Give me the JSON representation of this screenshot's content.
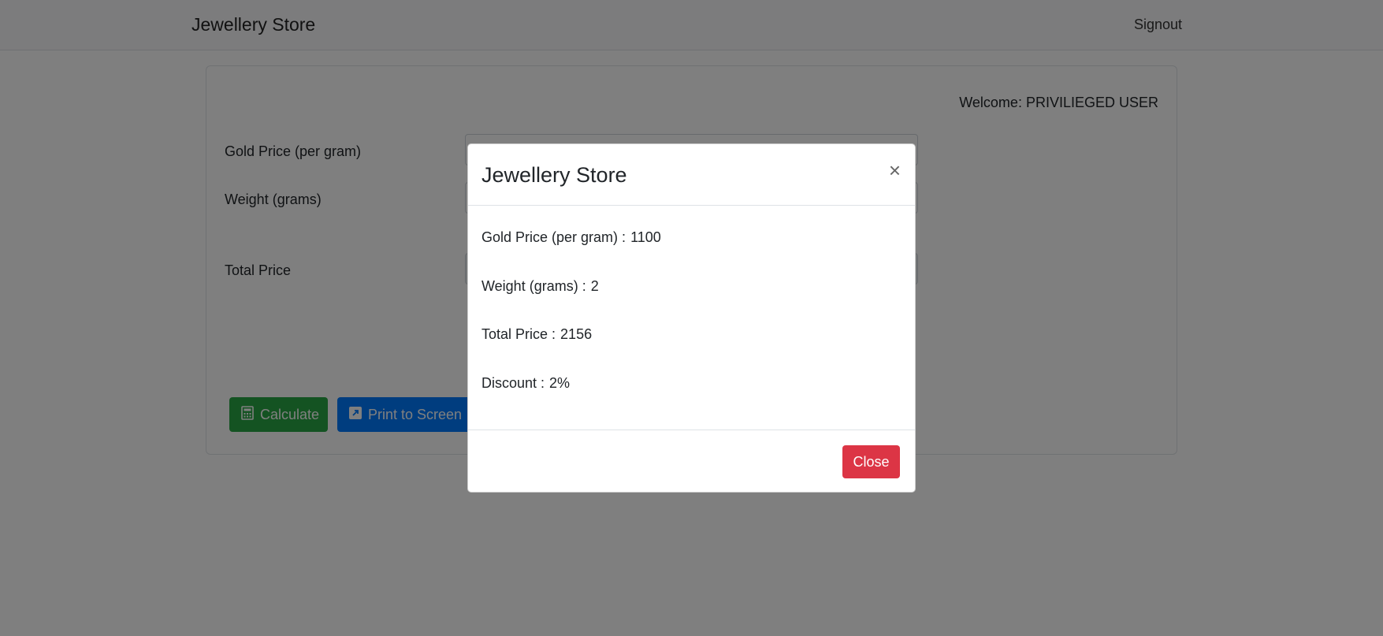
{
  "navbar": {
    "brand": "Jewellery Store",
    "signout": "Signout"
  },
  "card": {
    "welcome": "Welcome: PRIVILIEGED USER",
    "gold_price_label": "Gold Price (per gram)",
    "weight_label": "Weight (grams)",
    "total_price_label": "Total Price",
    "calculate_label": "Calculate",
    "print_label": "Print to Screen"
  },
  "modal": {
    "title": "Jewellery Store",
    "close_symbol": "×",
    "rows": [
      {
        "label": "Gold Price (per gram) :",
        "value": "1100"
      },
      {
        "label": "Weight (grams) :",
        "value": "2"
      },
      {
        "label": "Total Price :",
        "value": "2156"
      },
      {
        "label": "Discount :",
        "value": "2%"
      }
    ],
    "close_button": "Close"
  },
  "colors": {
    "success": "#28a745",
    "primary": "#007bff",
    "danger": "#dc3545"
  }
}
